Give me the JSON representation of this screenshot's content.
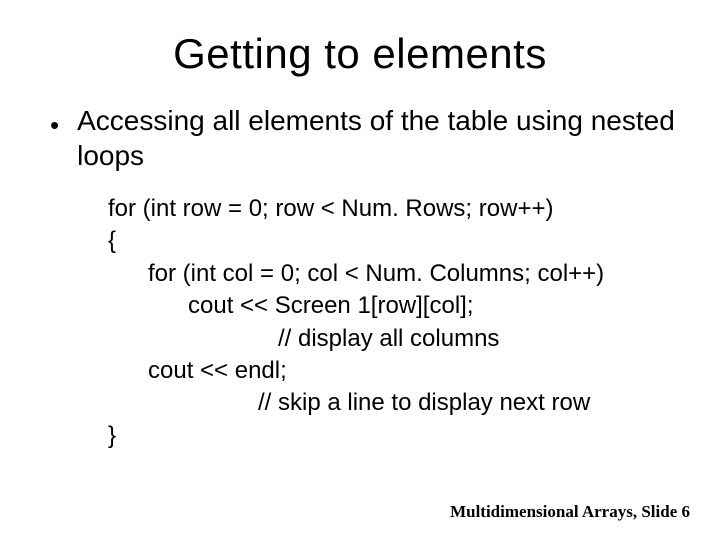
{
  "title": "Getting to elements",
  "bullet_text": "Accessing all elements of the table using nested loops",
  "code": {
    "l1": "for (int row = 0; row < Num. Rows; row++)",
    "l2": "{",
    "l3": "for (int col = 0; col < Num. Columns; col++)",
    "l4": "cout << Screen 1[row][col];",
    "l5": "// display all columns",
    "l6": "cout << endl;",
    "l7": "// skip a line to display next row",
    "l8": "}"
  },
  "footer": "Multidimensional Arrays, Slide 6"
}
